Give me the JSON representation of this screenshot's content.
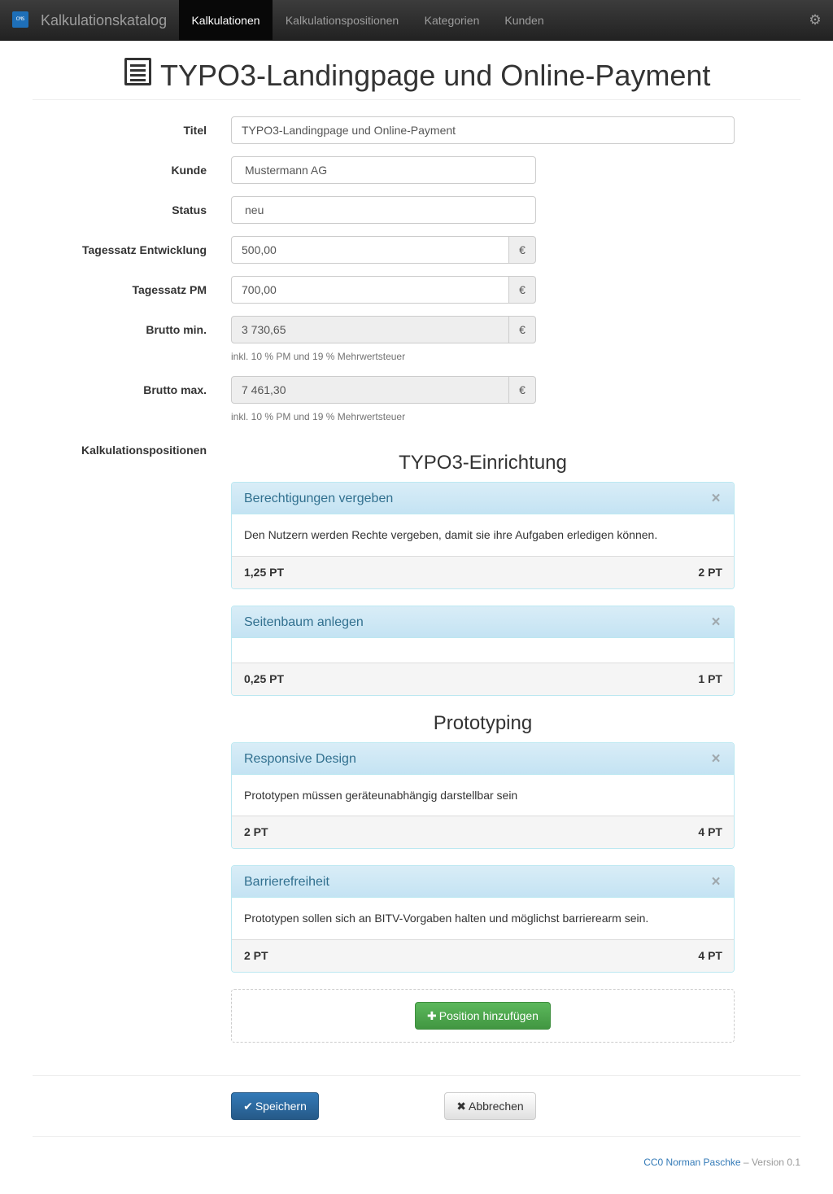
{
  "navbar": {
    "brand": "Kalkulationskatalog",
    "logo_icon": "cms-logo-icon",
    "items": [
      {
        "label": "Kalkulationen",
        "active": true
      },
      {
        "label": "Kalkulationspositionen",
        "active": false
      },
      {
        "label": "Kategorien",
        "active": false
      },
      {
        "label": "Kunden",
        "active": false
      }
    ],
    "settings_icon": "gear-icon"
  },
  "page": {
    "title": "TYPO3-Landingpage und Online-Payment",
    "title_icon": "list-alt-icon"
  },
  "form": {
    "titel": {
      "label": "Titel",
      "value": "TYPO3-Landingpage und Online-Payment"
    },
    "kunde": {
      "label": "Kunde",
      "value": "Mustermann AG"
    },
    "status": {
      "label": "Status",
      "value": "neu"
    },
    "tagessatz_entwicklung": {
      "label": "Tagessatz Entwicklung",
      "value": "500,00",
      "unit": "€"
    },
    "tagessatz_pm": {
      "label": "Tagessatz PM",
      "value": "700,00",
      "unit": "€"
    },
    "brutto_min": {
      "label": "Brutto min.",
      "value": "3 730,65",
      "unit": "€",
      "help": "inkl. 10 % PM und 19 % Mehrwertsteuer"
    },
    "brutto_max": {
      "label": "Brutto max.",
      "value": "7 461,30",
      "unit": "€",
      "help": "inkl. 10 % PM und 19 % Mehrwertsteuer"
    },
    "positions_label": "Kalkulationspositionen"
  },
  "groups": [
    {
      "heading": "TYPO3-Einrichtung",
      "positions": [
        {
          "title": "Berechtigungen vergeben",
          "description": "Den Nutzern werden Rechte vergeben, damit sie ihre Aufgaben erledigen können.",
          "min": "1,25 PT",
          "max": "2 PT"
        },
        {
          "title": "Seitenbaum anlegen",
          "description": "",
          "min": "0,25 PT",
          "max": "1 PT"
        }
      ]
    },
    {
      "heading": "Prototyping",
      "positions": [
        {
          "title": "Responsive Design",
          "description": "Prototypen müssen geräteunabhängig darstellbar sein",
          "min": "2 PT",
          "max": "4 PT"
        },
        {
          "title": "Barrierefreiheit",
          "description": "Prototypen sollen sich an BITV-Vorgaben halten und möglichst barrierearm sein.",
          "min": "2 PT",
          "max": "4 PT"
        }
      ]
    }
  ],
  "close_glyph": "×",
  "buttons": {
    "add_position": "Position hinzufügen",
    "save": "Speichern",
    "cancel": "Abbrechen"
  },
  "footer": {
    "author": "CC0 Norman Paschke",
    "separator": "–",
    "version": "Version 0.1"
  },
  "colors": {
    "navbar": "#222222",
    "primary": "#337ab7",
    "success": "#5cb85c",
    "panel_info": "#d9edf7",
    "panel_title": "#31708f"
  }
}
